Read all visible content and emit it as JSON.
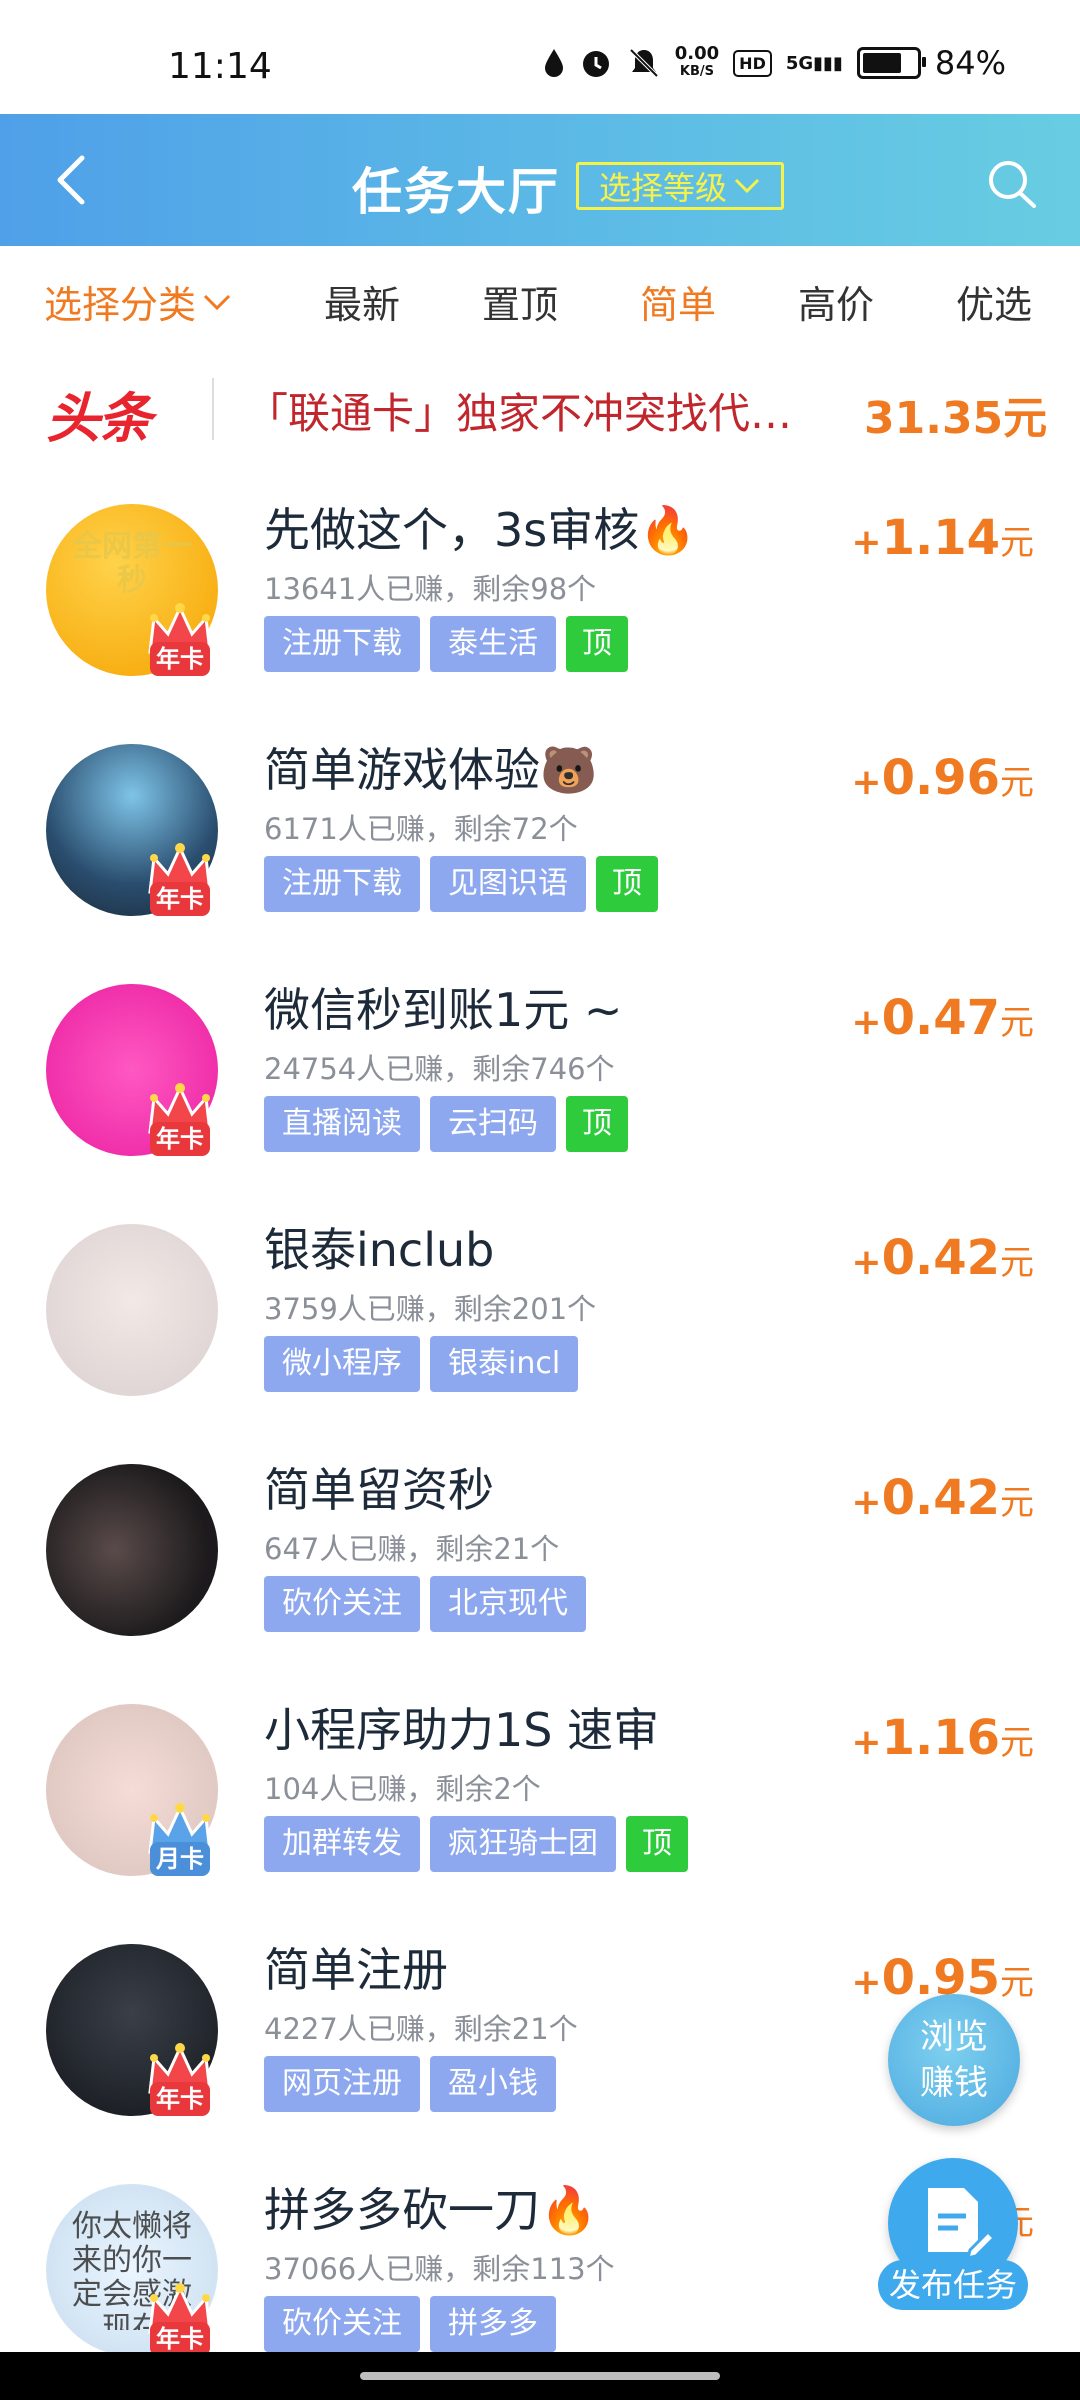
{
  "status_bar": {
    "time": "11:14",
    "speed_top": "0.00",
    "speed_unit": "KB/S",
    "hd": "HD",
    "network": "5G",
    "battery_percent": "84%",
    "battery_level": 0.84
  },
  "header": {
    "title": "任务大厅",
    "level_select": "选择等级"
  },
  "tabs": {
    "category": "选择分类",
    "items": [
      "最新",
      "置顶",
      "简单",
      "高价",
      "优选"
    ],
    "active": "简单"
  },
  "headline": {
    "badge": "头条",
    "text": "「联通卡」独家不冲突找代…",
    "amount": "31.35元"
  },
  "tasks": [
    {
      "title": "先做这个，3s审核🔥",
      "stats": "13641人已赚，剩余98个",
      "tags": [
        "注册下载",
        "泰生活"
      ],
      "top_tag": "顶",
      "plus": "+",
      "price": "1.14",
      "unit": "元",
      "vip": "年卡",
      "avatar_text": "全网第一秒"
    },
    {
      "title": "简单游戏体验🐻",
      "stats": "6171人已赚，剩余72个",
      "tags": [
        "注册下载",
        "见图识语"
      ],
      "top_tag": "顶",
      "plus": "+",
      "price": "0.96",
      "unit": "元",
      "vip": "年卡"
    },
    {
      "title": "微信秒到账1元 ~",
      "stats": "24754人已赚，剩余746个",
      "tags": [
        "直播阅读",
        "云扫码"
      ],
      "top_tag": "顶",
      "plus": "+",
      "price": "0.47",
      "unit": "元",
      "vip": "年卡"
    },
    {
      "title": "银泰inclub",
      "stats": "3759人已赚，剩余201个",
      "tags": [
        "微小程序",
        "银泰incl"
      ],
      "top_tag": "",
      "plus": "+",
      "price": "0.42",
      "unit": "元",
      "vip": ""
    },
    {
      "title": "简单留资秒",
      "stats": "647人已赚，剩余21个",
      "tags": [
        "砍价关注",
        "北京现代"
      ],
      "top_tag": "",
      "plus": "+",
      "price": "0.42",
      "unit": "元",
      "vip": ""
    },
    {
      "title": "小程序助力1S 速审",
      "stats": "104人已赚，剩余2个",
      "tags": [
        "加群转发",
        "疯狂骑士团"
      ],
      "top_tag": "顶",
      "plus": "+",
      "price": "1.16",
      "unit": "元",
      "vip": "月卡"
    },
    {
      "title": "简单注册",
      "stats": "4227人已赚，剩余21个",
      "tags": [
        "网页注册",
        "盈小钱"
      ],
      "top_tag": "",
      "plus": "+",
      "price": "0.95",
      "unit": "元",
      "vip": "年卡"
    },
    {
      "title": "拼多多砍一刀🔥",
      "stats": "37066人已赚，剩余113个",
      "tags": [
        "砍价关注",
        "拼多多"
      ],
      "top_tag": "",
      "plus": "+",
      "price": "",
      "unit": "元",
      "vip": "年卡",
      "avatar_text": "你太懒将来的你一定会感激现在"
    }
  ],
  "fab": {
    "browse_line1": "浏览",
    "browse_line2": "赚钱",
    "publish": "发布任务"
  },
  "colors": {
    "accent_orange": "#f07a22",
    "tag_blue": "#8ea8f0",
    "tag_green": "#2ecb3c",
    "header_start": "#4fa0e8",
    "header_end": "#68cde2",
    "headline_red": "#c0262c"
  }
}
